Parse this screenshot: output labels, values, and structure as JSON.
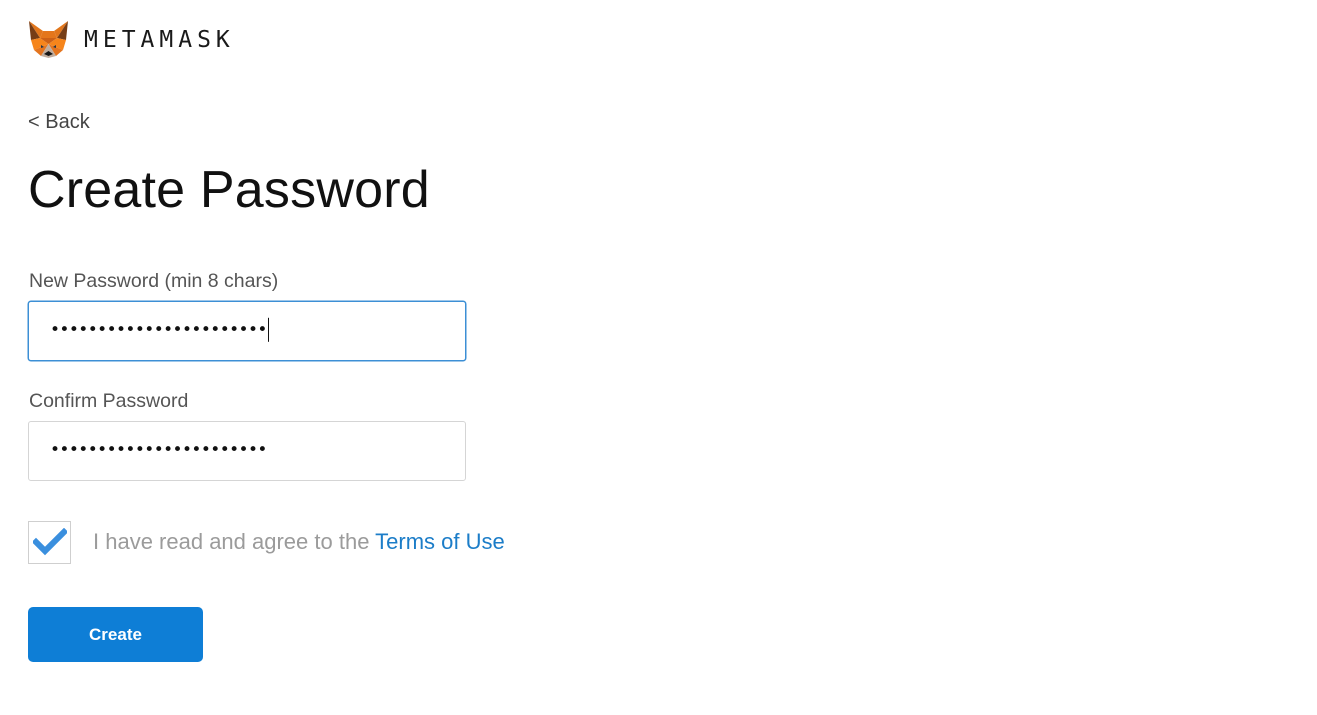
{
  "header": {
    "logo_icon": "metamask-fox-icon",
    "brand": "METAMASK"
  },
  "nav": {
    "back_label": "< Back"
  },
  "page": {
    "title": "Create Password"
  },
  "form": {
    "new_password": {
      "label": "New Password (min 8 chars)",
      "masked_value": "•••••••••••••••••••••••",
      "focused": true
    },
    "confirm_password": {
      "label": "Confirm Password",
      "masked_value": "•••••••••••••••••••••••"
    },
    "terms": {
      "checked": true,
      "check_icon": "checkmark-icon",
      "text": "I have read and agree to the ",
      "link_text": "Terms of Use"
    },
    "submit_label": "Create"
  },
  "colors": {
    "accent": "#0e7ed6",
    "link": "#1c7dc8",
    "check": "#3a8fde",
    "focus_border": "#3c8fd5"
  }
}
